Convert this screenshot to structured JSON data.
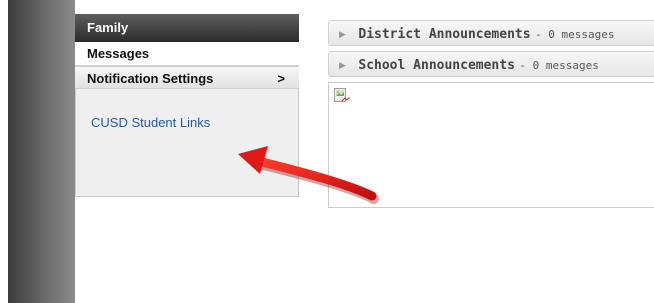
{
  "nav": {
    "family": "Family",
    "messages": "Messages",
    "notification_settings": "Notification Settings",
    "notification_chevron": ">",
    "links": [
      "CUSD Student Links"
    ]
  },
  "announcements": [
    {
      "title": "District Announcements",
      "count": "- 0 messages"
    },
    {
      "title": "School Announcements",
      "count": "- 0 messages"
    }
  ],
  "colors": {
    "annotation_arrow": "#e01818",
    "link": "#1f5ca8"
  },
  "icons": {
    "expand": "triangle-right-icon",
    "image": "broken-image-icon"
  }
}
